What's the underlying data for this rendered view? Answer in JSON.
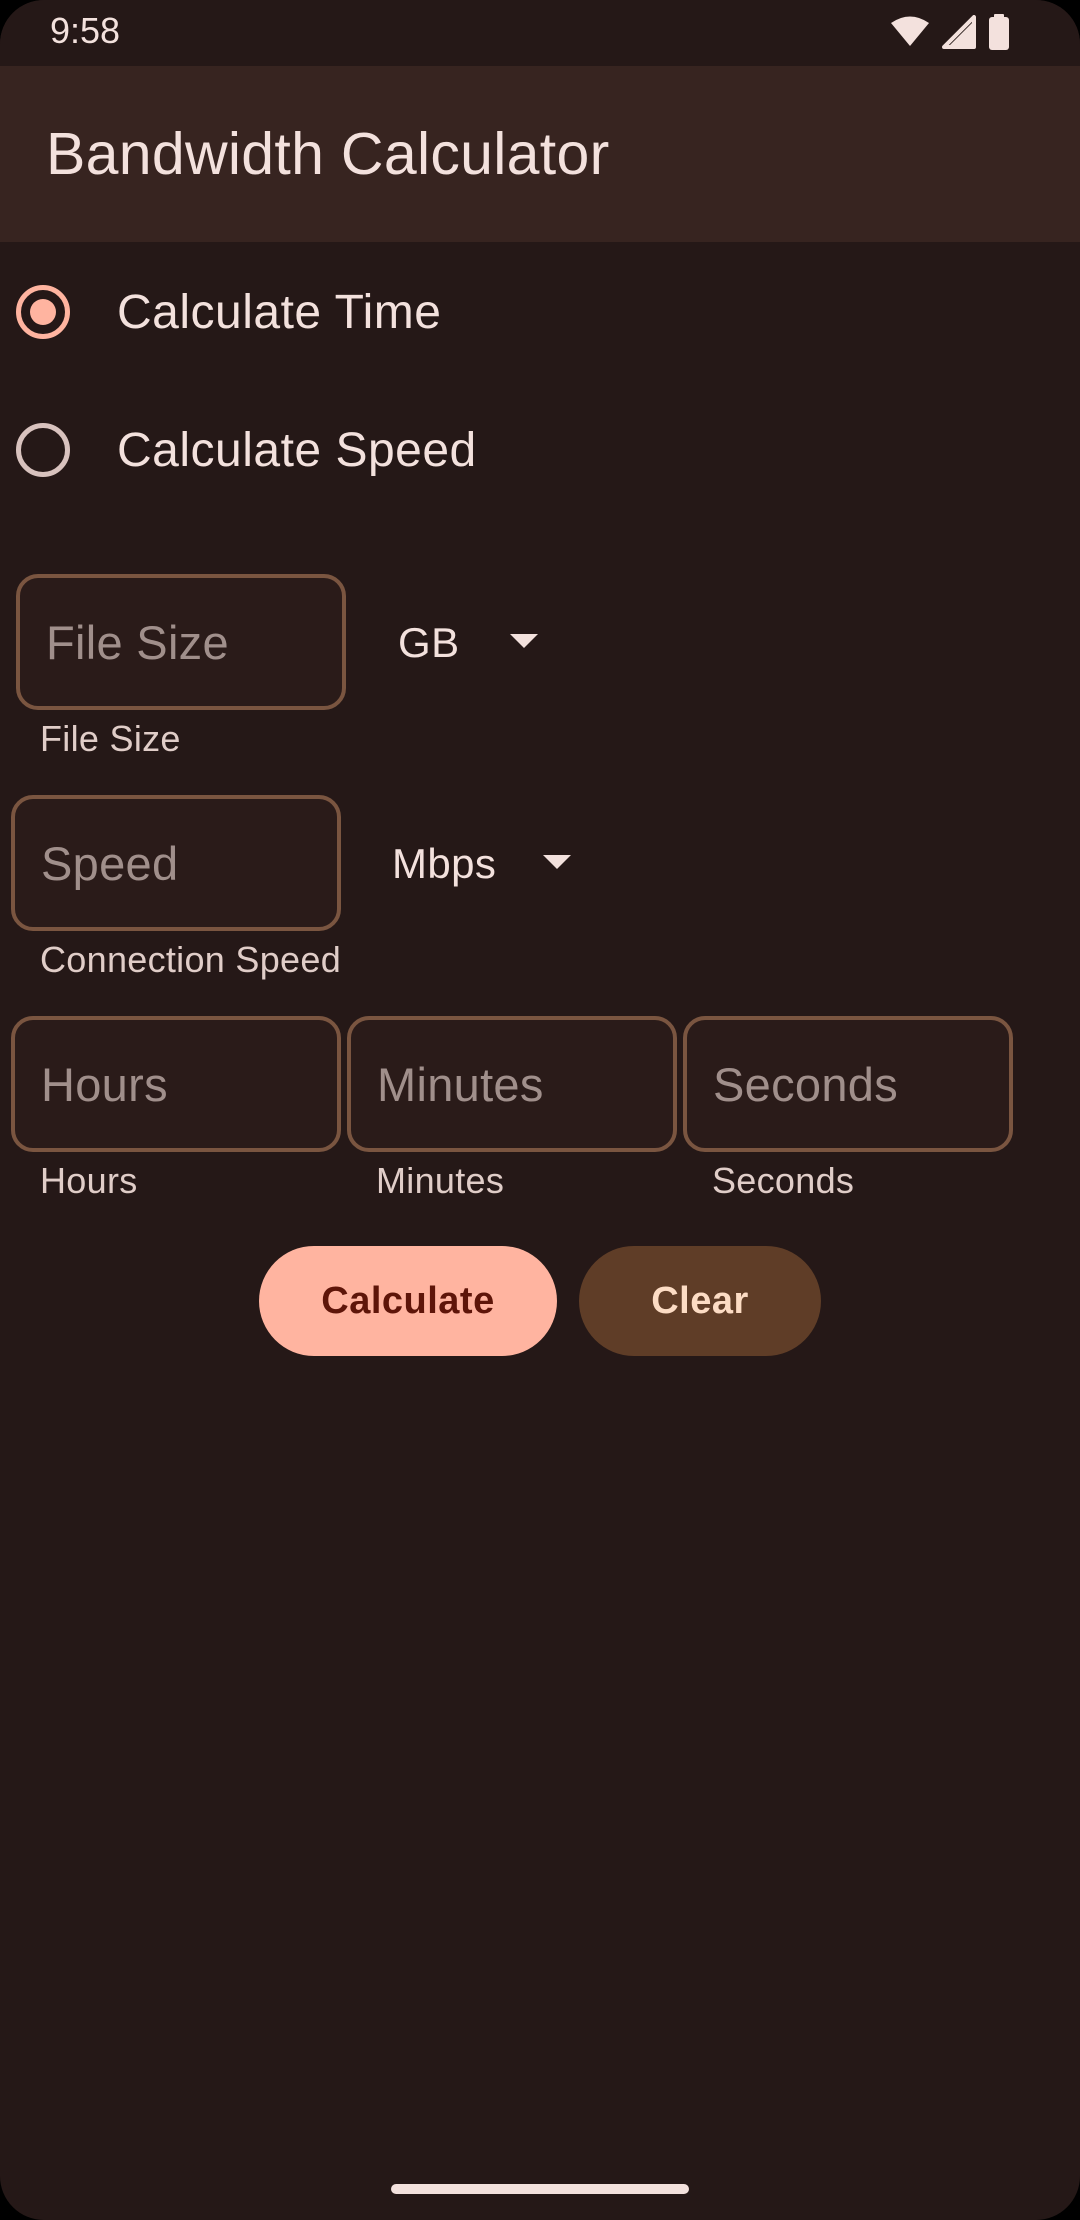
{
  "status_bar": {
    "time": "9:58",
    "icons": [
      "wifi-icon",
      "signal-icon",
      "battery-icon"
    ]
  },
  "app_bar": {
    "title": "Bandwidth Calculator"
  },
  "mode": {
    "options": [
      {
        "label": "Calculate Time",
        "checked": true
      },
      {
        "label": "Calculate Speed",
        "checked": false
      }
    ]
  },
  "file_size": {
    "placeholder": "File Size",
    "value": "",
    "helper": "File Size",
    "unit": "GB"
  },
  "speed": {
    "placeholder": "Speed",
    "value": "",
    "helper": "Connection Speed",
    "unit": "Mbps"
  },
  "time_fields": [
    {
      "placeholder": "Hours",
      "value": "",
      "helper": "Hours"
    },
    {
      "placeholder": "Minutes",
      "value": "",
      "helper": "Minutes"
    },
    {
      "placeholder": "Seconds",
      "value": "",
      "helper": "Seconds"
    }
  ],
  "buttons": {
    "calculate": "Calculate",
    "clear": "Clear"
  },
  "colors": {
    "background": "#251817",
    "app_bar": "#372420",
    "accent": "#ffb4a0",
    "field_outline": "#7a5540",
    "secondary_button": "#5f3d27",
    "text": "#f3e1dd"
  }
}
